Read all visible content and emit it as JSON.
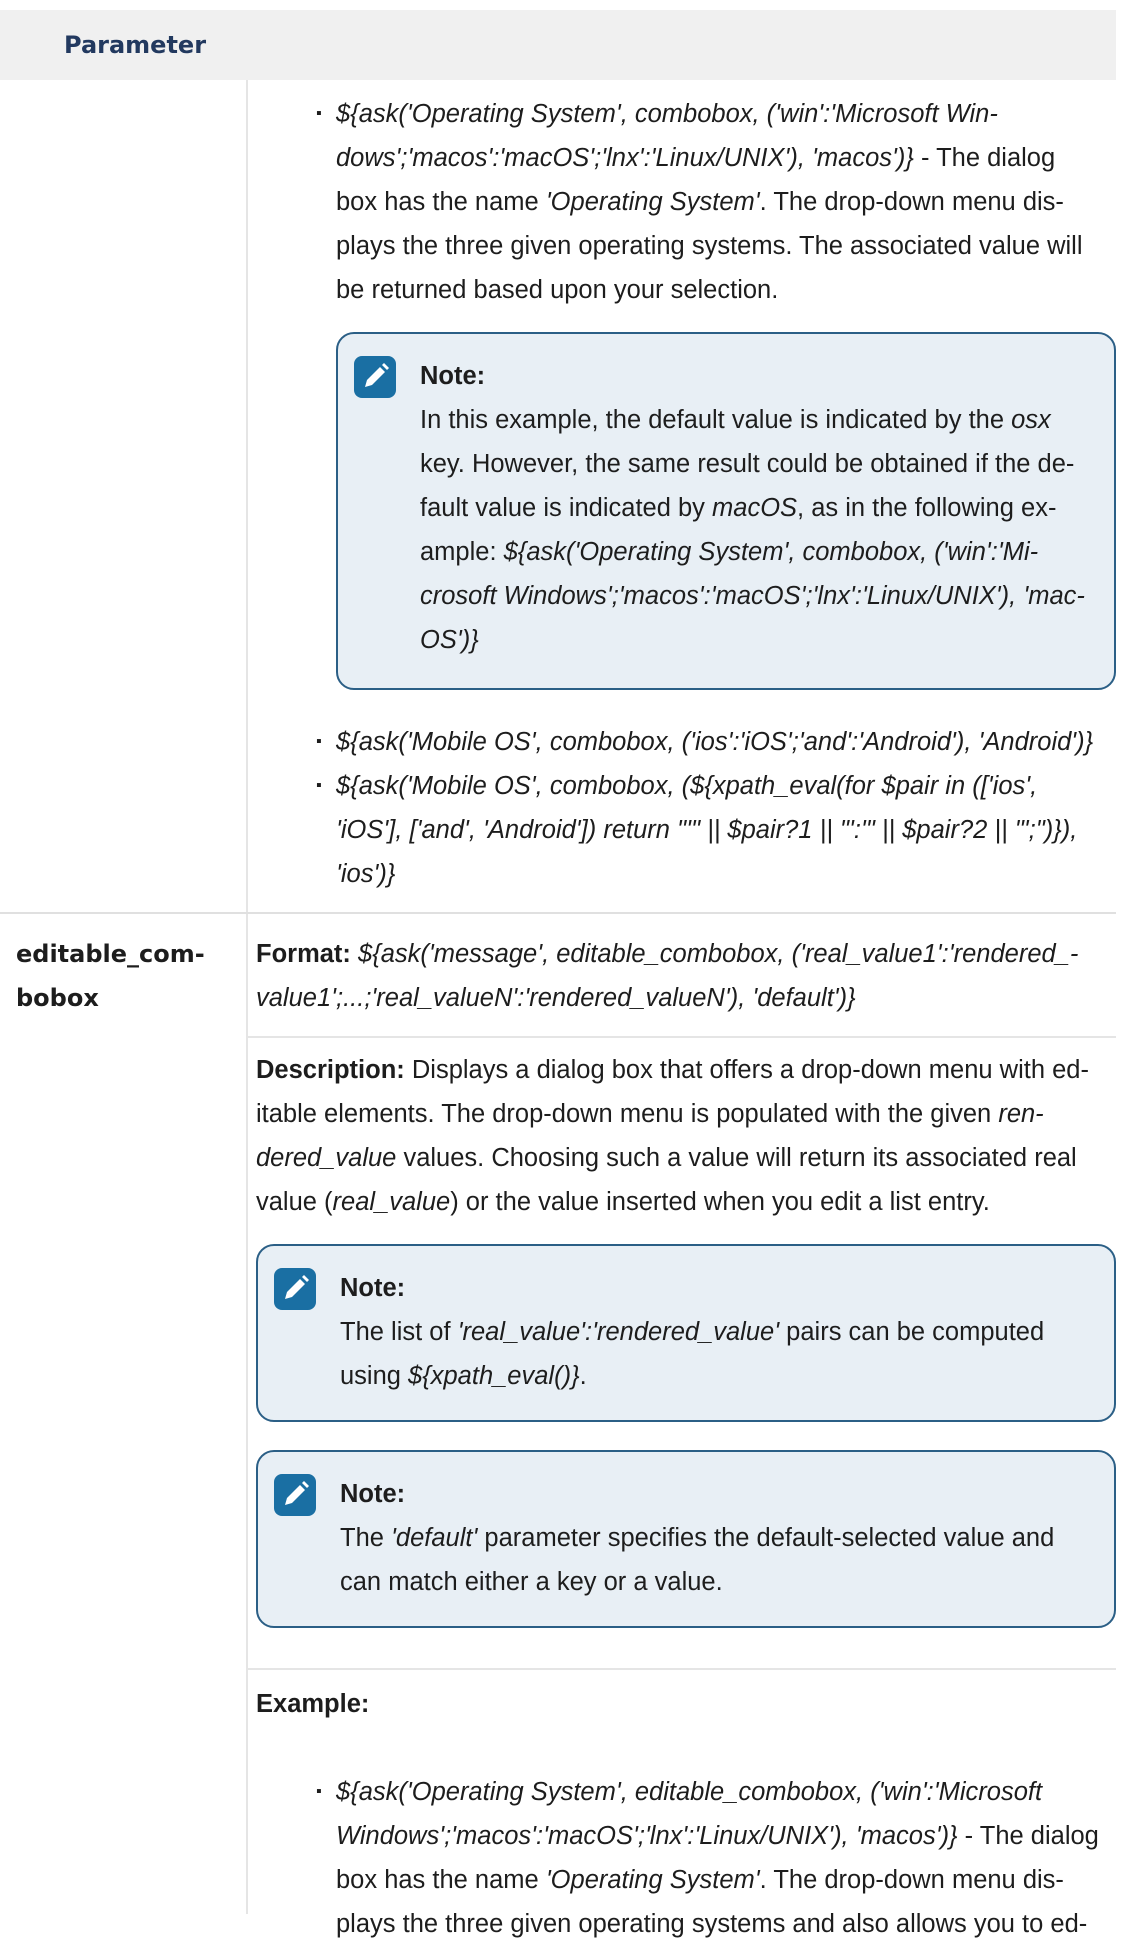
{
  "header": {
    "parameter": "Parameter"
  },
  "row1": {
    "ex1_code": "${ask('Operating System', combobox, ('win':'Microsoft Win-",
    "ex1_code_b": "dows';'macos':'macOS';'lnx':'Linux/UNIX'), 'macos')}",
    "ex1_rest_a": " - The dialog",
    "ex1_l3_a": "box has the name ",
    "ex1_l3_b": "'Operating System'",
    "ex1_l3_c": ". The drop-down menu dis-",
    "ex1_l4": "plays the three given operating systems. The associated value will",
    "ex1_l5": "be returned based upon your selection.",
    "note_title": "Note:",
    "note_l1_a": "In this example, the default value is indicated by the ",
    "note_l1_b": "osx",
    "note_l2": "key. However, the same result could be obtained if the de-",
    "note_l3_a": "fault value is indicated by ",
    "note_l3_b": "macOS",
    "note_l3_c": ", as in the following ex-",
    "note_l4_a": "ample: ",
    "note_l4_b": "${ask('Operating System', combobox, ('win':'Mi-",
    "note_l5": "crosoft Windows';'macos':'macOS';'lnx':'Linux/UNIX'), 'mac-",
    "note_l6": "OS')}",
    "ex2": "${ask('Mobile OS', combobox, ('ios':'iOS';'and':'Android'), 'Android')}",
    "ex3_l1": "${ask('Mobile OS', combobox, (${xpath_eval(for $pair in (['ios',",
    "ex3_l2": "'iOS'], ['and', 'Android']) return \"'\" || $pair?1 || \"':'\" || $pair?2 || \"';\")}),",
    "ex3_l3": "'ios')}"
  },
  "row2": {
    "param_l1": "editable_com-",
    "param_l2": "bobox",
    "format_label": "Format:",
    "format_l1": " ${ask('message', editable_combobox, ('real_value1':'rendered_-",
    "format_l2": "value1';...;'real_valueN':'rendered_valueN'), 'default')}",
    "desc_label": "Description:",
    "desc_l1": " Displays a dialog box that offers a drop-down menu with ed-",
    "desc_l2_a": "itable elements. The drop-down menu is populated with the given ",
    "desc_l2_b": "ren-",
    "desc_l3_a": "dered_value",
    "desc_l3_b": " values. Choosing such a value will return its associated real",
    "desc_l4_a": "value (",
    "desc_l4_b": "real_value",
    "desc_l4_c": ") or the value inserted when you edit a list entry.",
    "note1_title": "Note:",
    "note1_l1_a": "The list of ",
    "note1_l1_b": "'real_value':'rendered_value'",
    "note1_l1_c": " pairs can be computed",
    "note1_l2_a": "using ",
    "note1_l2_b": "${xpath_eval()}",
    "note1_l2_c": ".",
    "note2_title": "Note:",
    "note2_l1_a": "The ",
    "note2_l1_b": "'default'",
    "note2_l1_c": " parameter specifies the default-selected value and",
    "note2_l2": "can match either a key or a value.",
    "example_label": "Example:",
    "ex_l1": "${ask('Operating System', editable_combobox, ('win':'Microsoft",
    "ex_l2_a": "Windows';'macos':'macOS';'lnx':'Linux/UNIX'), 'macos')}",
    "ex_l2_b": " - The dialog",
    "ex_l3_a": "box has the name ",
    "ex_l3_b": "'Operating System'",
    "ex_l3_c": ". The drop-down menu dis-",
    "ex_l4": "plays the three given operating systems and also allows you to ed-"
  }
}
